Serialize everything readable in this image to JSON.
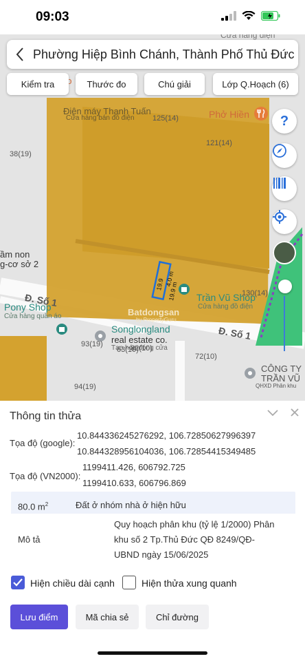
{
  "status": {
    "time": "09:03"
  },
  "header": {
    "title": "Phường Hiệp Bình Chánh, Thành Phố Thủ Đức"
  },
  "toolbar": {
    "check": "Kiểm tra",
    "measure": "Thước đo",
    "legend": "Chú giải",
    "layers": "Lớp Q.Hoạch (6)"
  },
  "map": {
    "labels": {
      "top_poi": "Cửa hàng điện",
      "tl_marker": "bo",
      "dienmay": "Điện máy Thanh Tuấn",
      "dienmay_sub": "Cửa hàng bán đồ điện",
      "lot_125": "125(14)",
      "phohien": "Phở Hiền",
      "lot_121": "121(14)",
      "lot_38": "38(19)",
      "mamnon1": "ầm non",
      "mamnon2": "g-cơ sở 2",
      "lot_130": "130(14)",
      "road_so1_left": "Đ. Số 1",
      "road_so1_right": "Đ. Số 1",
      "tranvu": "Trần Vũ Shop",
      "tranvu_sub": "Cửa hàng đồ điện",
      "pony": "Pony Shop",
      "pony_sub": "Cửa hàng quần áo",
      "watermark": "Batdongsan",
      "watermark_sub": "by PropertyGuru",
      "songlong": "Songlongland",
      "songlong_sub": "real estate co.",
      "songlong_sub2": "Tạp hóa đóng cửa",
      "lot_93": "93(19)",
      "lot_82": "82(10)",
      "lot_63": "63(10)",
      "lot_72": "72(10)",
      "lot_94": "94(19)",
      "congty1": "CÔNG TY",
      "congty2": "TRẦN VŨ",
      "qhxd": "QHXD Phân khu",
      "dim1": "19.9",
      "dim2": "4.0 m",
      "dim3": "19.9 m"
    }
  },
  "panel": {
    "title": "Thông tin thửa",
    "google_label": "Tọa độ (google):",
    "google_1": "10.844336245276292, 106.72850627996397",
    "google_2": "10.844328956104036, 106.72854415349485",
    "vn_label": "Tọa độ (VN2000):",
    "vn_1": "1199411.426, 606792.725",
    "vn_2": "1199410.633, 606796.869",
    "area": "80.0 m",
    "area_sup": "2",
    "landuse": "Đất ở nhóm nhà ở hiện hữu",
    "desc_label": "Mô tả",
    "desc_1": "Quy hoạch phân khu (tỷ lệ 1/2000) Phân",
    "desc_2": "khu số 2 Tp.Thủ Đức QĐ 8249/QĐ-",
    "desc_3": "UBND ngày 15/06/2025",
    "chk_edges": "Hiện chiều dài cạnh",
    "chk_neighbors": "Hiện thửa xung quanh",
    "btn_save": "Lưu điểm",
    "btn_share": "Mã chia sẻ",
    "btn_directions": "Chỉ đường"
  },
  "colors": {
    "zone": "#d4a22f",
    "accent": "#5b4fd9",
    "check": "#4a5bd8"
  }
}
